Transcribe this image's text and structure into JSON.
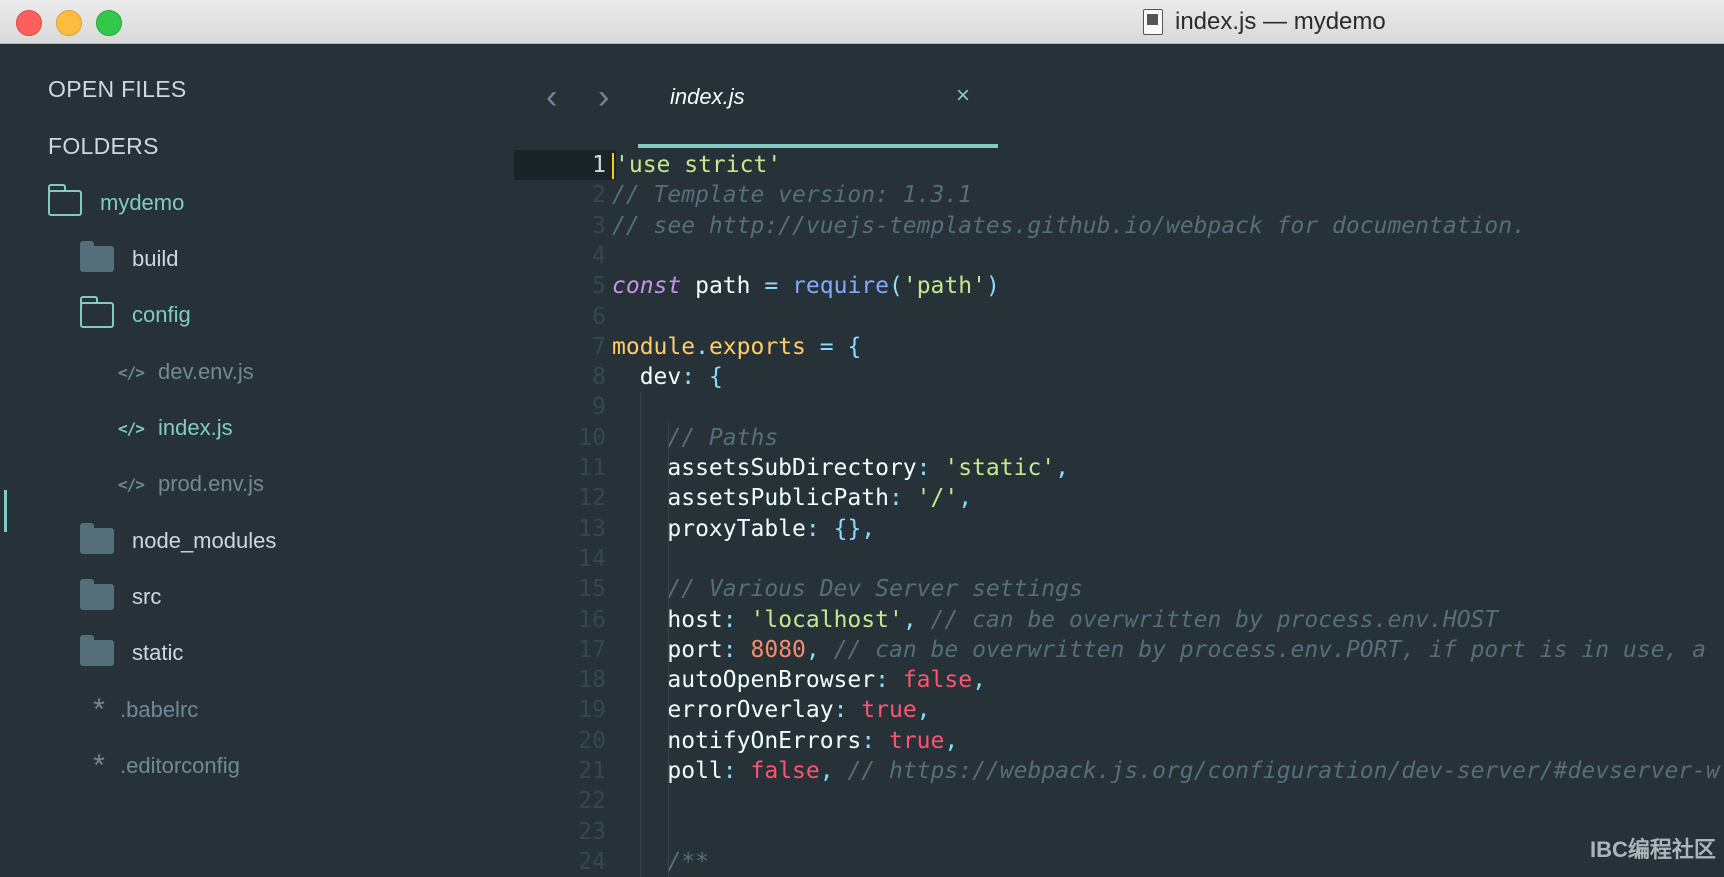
{
  "window": {
    "title": "index.js — mydemo"
  },
  "sidebar": {
    "open_files_heading": "OPEN FILES",
    "folders_heading": "FOLDERS",
    "tree": [
      {
        "label": "mydemo",
        "type": "folder-open",
        "color": "#80cbc4"
      },
      {
        "label": "build",
        "type": "folder-closed",
        "color": "#cfd8dc"
      },
      {
        "label": "config",
        "type": "folder-open",
        "color": "#80cbc4"
      },
      {
        "label": "dev.env.js",
        "type": "file-code",
        "color": "#6f8a95"
      },
      {
        "label": "index.js",
        "type": "file-code",
        "color": "#80cbc4",
        "selected": true
      },
      {
        "label": "prod.env.js",
        "type": "file-code",
        "color": "#6f8a95"
      },
      {
        "label": "node_modules",
        "type": "folder-closed",
        "color": "#cfd8dc"
      },
      {
        "label": "src",
        "type": "folder-closed",
        "color": "#cfd8dc"
      },
      {
        "label": "static",
        "type": "folder-closed",
        "color": "#cfd8dc"
      },
      {
        "label": ".babelrc",
        "type": "file-config",
        "color": "#6f8a95"
      },
      {
        "label": ".editorconfig",
        "type": "file-config",
        "color": "#6f8a95"
      }
    ]
  },
  "tabs": [
    {
      "label": "index.js",
      "active": true,
      "close_glyph": "×"
    }
  ],
  "nav": {
    "back_glyph": "‹",
    "forward_glyph": "›"
  },
  "editor": {
    "current_line": 1,
    "lines": [
      {
        "n": "1",
        "tokens": [
          [
            "str",
            "'use strict'"
          ]
        ]
      },
      {
        "n": "2",
        "tokens": [
          [
            "comment",
            "// Template version: 1.3.1"
          ]
        ]
      },
      {
        "n": "3",
        "tokens": [
          [
            "comment",
            "// see http://vuejs-templates.github.io/webpack for documentation."
          ]
        ]
      },
      {
        "n": "4",
        "tokens": []
      },
      {
        "n": "5",
        "tokens": [
          [
            "keyword",
            "const"
          ],
          [
            "var",
            " path "
          ],
          [
            "op",
            "="
          ],
          [
            "var",
            " "
          ],
          [
            "func",
            "require"
          ],
          [
            "punc",
            "("
          ],
          [
            "str",
            "'path'"
          ],
          [
            "punc",
            ")"
          ]
        ]
      },
      {
        "n": "6",
        "tokens": []
      },
      {
        "n": "7",
        "tokens": [
          [
            "module",
            "module"
          ],
          [
            "punc",
            "."
          ],
          [
            "module",
            "exports"
          ],
          [
            "var",
            " "
          ],
          [
            "op",
            "="
          ],
          [
            "var",
            " "
          ],
          [
            "punc",
            "{"
          ]
        ]
      },
      {
        "n": "8",
        "tokens": [
          [
            "prop",
            "  dev"
          ],
          [
            "punc",
            ":"
          ],
          [
            "var",
            " "
          ],
          [
            "punc",
            "{"
          ]
        ]
      },
      {
        "n": "9",
        "tokens": []
      },
      {
        "n": "10",
        "tokens": [
          [
            "comment",
            "    // Paths"
          ]
        ]
      },
      {
        "n": "11",
        "tokens": [
          [
            "prop",
            "    assetsSubDirectory"
          ],
          [
            "punc",
            ":"
          ],
          [
            "var",
            " "
          ],
          [
            "str",
            "'static'"
          ],
          [
            "punc",
            ","
          ]
        ]
      },
      {
        "n": "12",
        "tokens": [
          [
            "prop",
            "    assetsPublicPath"
          ],
          [
            "punc",
            ":"
          ],
          [
            "var",
            " "
          ],
          [
            "str",
            "'/'"
          ],
          [
            "punc",
            ","
          ]
        ]
      },
      {
        "n": "13",
        "tokens": [
          [
            "prop",
            "    proxyTable"
          ],
          [
            "punc",
            ":"
          ],
          [
            "var",
            " "
          ],
          [
            "punc",
            "{},"
          ]
        ]
      },
      {
        "n": "14",
        "tokens": []
      },
      {
        "n": "15",
        "tokens": [
          [
            "comment",
            "    // Various Dev Server settings"
          ]
        ]
      },
      {
        "n": "16",
        "tokens": [
          [
            "prop",
            "    host"
          ],
          [
            "punc",
            ":"
          ],
          [
            "var",
            " "
          ],
          [
            "str",
            "'localhost'"
          ],
          [
            "punc",
            ","
          ],
          [
            "comment",
            " // can be overwritten by process.env.HOST"
          ]
        ]
      },
      {
        "n": "17",
        "tokens": [
          [
            "prop",
            "    port"
          ],
          [
            "punc",
            ":"
          ],
          [
            "var",
            " "
          ],
          [
            "num",
            "8080"
          ],
          [
            "punc",
            ","
          ],
          [
            "comment",
            " // can be overwritten by process.env.PORT, if port is in use, a"
          ]
        ]
      },
      {
        "n": "18",
        "tokens": [
          [
            "prop",
            "    autoOpenBrowser"
          ],
          [
            "punc",
            ":"
          ],
          [
            "var",
            " "
          ],
          [
            "bool",
            "false"
          ],
          [
            "punc",
            ","
          ]
        ]
      },
      {
        "n": "19",
        "tokens": [
          [
            "prop",
            "    errorOverlay"
          ],
          [
            "punc",
            ":"
          ],
          [
            "var",
            " "
          ],
          [
            "bool",
            "true"
          ],
          [
            "punc",
            ","
          ]
        ]
      },
      {
        "n": "20",
        "tokens": [
          [
            "prop",
            "    notifyOnErrors"
          ],
          [
            "punc",
            ":"
          ],
          [
            "var",
            " "
          ],
          [
            "bool",
            "true"
          ],
          [
            "punc",
            ","
          ]
        ]
      },
      {
        "n": "21",
        "tokens": [
          [
            "prop",
            "    poll"
          ],
          [
            "punc",
            ":"
          ],
          [
            "var",
            " "
          ],
          [
            "bool",
            "false"
          ],
          [
            "punc",
            ","
          ],
          [
            "comment",
            " // https://webpack.js.org/configuration/dev-server/#devserver-w"
          ]
        ]
      },
      {
        "n": "22",
        "tokens": []
      },
      {
        "n": "23",
        "tokens": []
      },
      {
        "n": "24",
        "tokens": [
          [
            "comment",
            "    /**"
          ]
        ]
      }
    ]
  },
  "watermark": "IBC编程社区",
  "colors": {
    "background": "#263238",
    "accent": "#80cbc4",
    "string": "#c3e88d",
    "comment": "#546e7a",
    "keyword": "#c792ea",
    "function": "#82aaff",
    "module": "#ffcb6b",
    "number": "#f78c6c",
    "boolean": "#ff5370"
  }
}
